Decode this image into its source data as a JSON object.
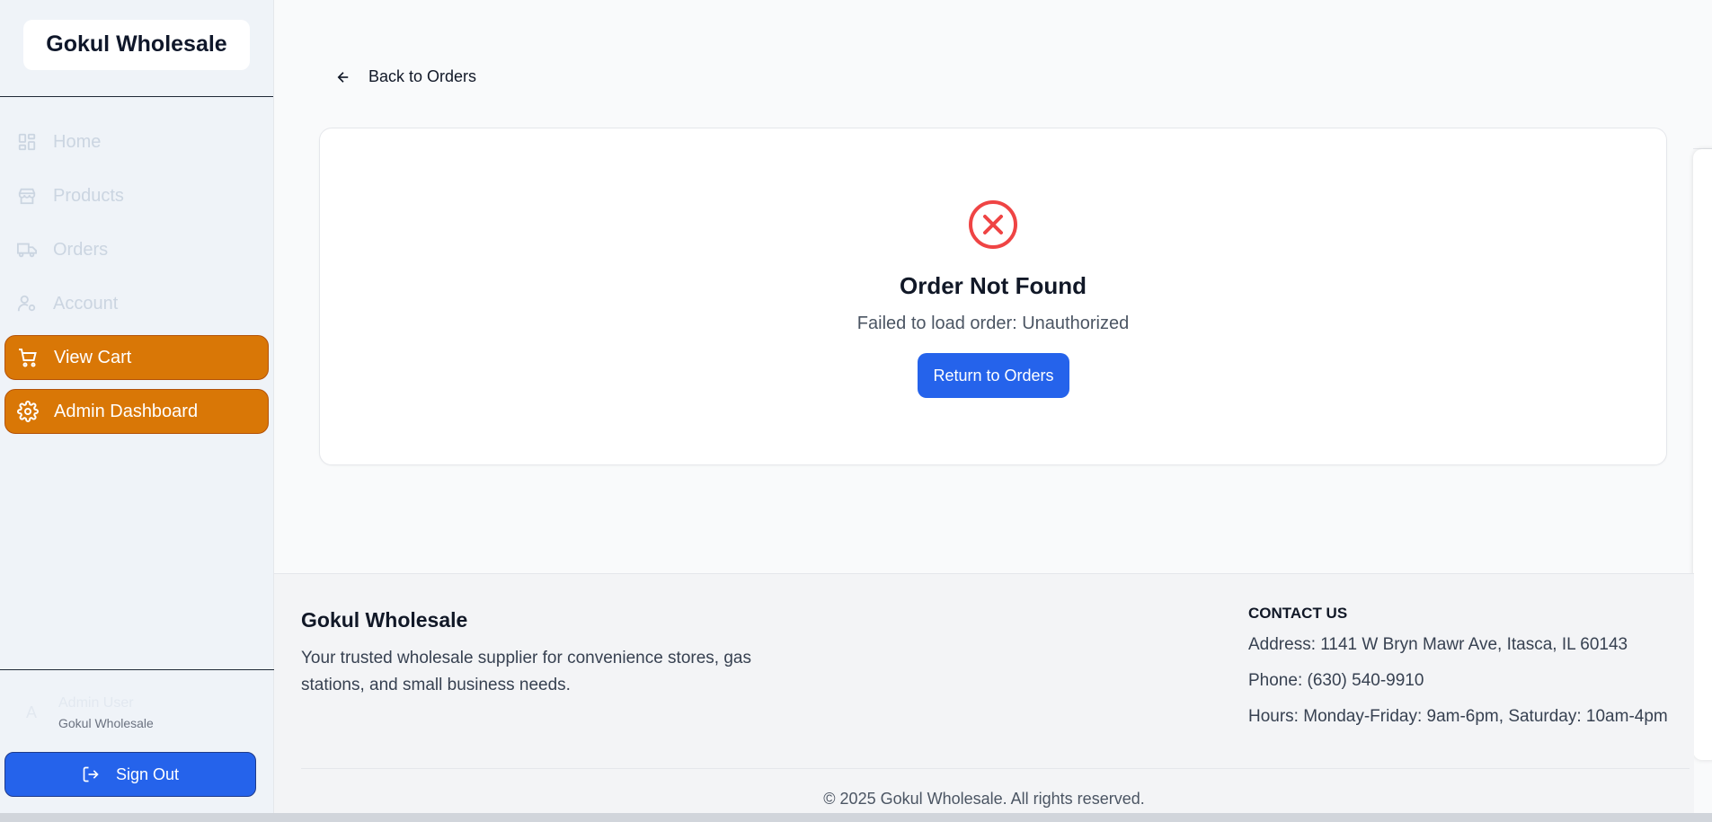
{
  "sidebar": {
    "brand": "Gokul Wholesale",
    "items": [
      {
        "label": "Home",
        "icon": "dashboard-grid-icon"
      },
      {
        "label": "Products",
        "icon": "store-icon"
      },
      {
        "label": "Orders",
        "icon": "truck-icon"
      },
      {
        "label": "Account",
        "icon": "user-gear-icon"
      },
      {
        "label": "View Cart",
        "icon": "cart-icon"
      },
      {
        "label": "Admin Dashboard",
        "icon": "gear-icon"
      }
    ],
    "user": {
      "initial": "A",
      "name": "Admin User",
      "org": "Gokul Wholesale"
    },
    "sign_out": "Sign Out"
  },
  "main": {
    "back_label": "Back to Orders",
    "error": {
      "title": "Order Not Found",
      "message": "Failed to load order: Unauthorized",
      "button": "Return to Orders"
    }
  },
  "footer": {
    "brand": "Gokul Wholesale",
    "description": "Your trusted wholesale supplier for convenience stores, gas stations, and small business needs.",
    "contact_heading": "CONTACT US",
    "address": "Address: 1141 W Bryn Mawr Ave, Itasca, IL 60143",
    "phone": "Phone: (630) 540-9910",
    "hours": "Hours: Monday-Friday: 9am-6pm, Saturday: 10am-4pm",
    "copyright": "© 2025 Gokul Wholesale. All rights reserved."
  },
  "colors": {
    "accent_orange": "#d97706",
    "primary_blue": "#2563eb",
    "error_red": "#ef4444"
  }
}
